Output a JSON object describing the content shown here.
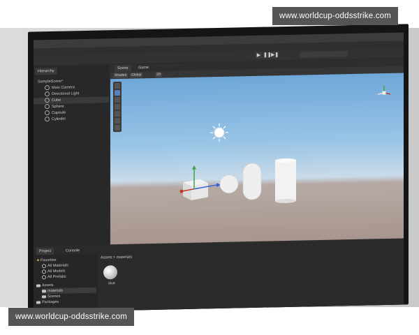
{
  "watermark": {
    "top": "www.worldcup-oddsstrike.com",
    "bottom": "www.worldcup-oddsstrike.com"
  },
  "editor": {
    "hierarchy_tab": "Hierarchy",
    "scene_name": "SampleScene*",
    "hierarchy_items": [
      "Main Camera",
      "Directional Light",
      "Cube",
      "Sphere",
      "Capsule",
      "Cylinder"
    ],
    "selected_hierarchy_item": "Cube",
    "scene_tab": "Scene",
    "game_tab": "Game",
    "shading_mode": "Shaded",
    "gizmo_mode": "Global",
    "mode_2d": "2D",
    "play_buttons": [
      "▶",
      "❚❚",
      "▶❚"
    ],
    "project_tab": "Project",
    "console_tab": "Console",
    "favorites_label": "Favorites",
    "favorites_items": [
      "All Materials",
      "All Models",
      "All Prefabs"
    ],
    "assets_label": "Assets",
    "assets_items": [
      "materials",
      "Scenes"
    ],
    "selected_asset_folder": "materials",
    "packages_label": "Packages",
    "breadcrumb": "Assets > materials",
    "asset_name": "blue"
  },
  "colors": {
    "sky_top": "#6ea7d8",
    "ground": "#a8968f",
    "watermark_bg": "#555555"
  }
}
